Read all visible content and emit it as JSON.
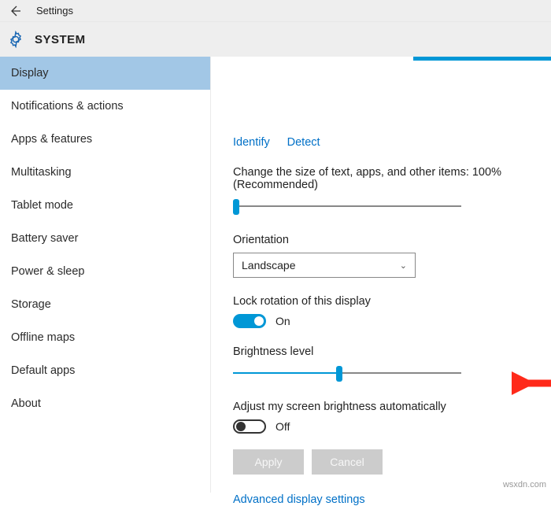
{
  "header": {
    "app_title": "Settings",
    "section": "SYSTEM"
  },
  "sidebar": {
    "items": [
      {
        "label": "Display",
        "selected": true
      },
      {
        "label": "Notifications & actions",
        "selected": false
      },
      {
        "label": "Apps & features",
        "selected": false
      },
      {
        "label": "Multitasking",
        "selected": false
      },
      {
        "label": "Tablet mode",
        "selected": false
      },
      {
        "label": "Battery saver",
        "selected": false
      },
      {
        "label": "Power & sleep",
        "selected": false
      },
      {
        "label": "Storage",
        "selected": false
      },
      {
        "label": "Offline maps",
        "selected": false
      },
      {
        "label": "Default apps",
        "selected": false
      },
      {
        "label": "About",
        "selected": false
      }
    ]
  },
  "content": {
    "identify_link": "Identify",
    "detect_link": "Detect",
    "scale_label": "Change the size of text, apps, and other items: 100% (Recommended)",
    "orientation_label": "Orientation",
    "orientation_value": "Landscape",
    "lock_rotation_label": "Lock rotation of this display",
    "lock_rotation_state": "On",
    "brightness_label": "Brightness level",
    "auto_brightness_label": "Adjust my screen brightness automatically",
    "auto_brightness_state": "Off",
    "apply_btn": "Apply",
    "cancel_btn": "Cancel",
    "advanced_link": "Advanced display settings"
  },
  "watermark": "wsxdn.com"
}
